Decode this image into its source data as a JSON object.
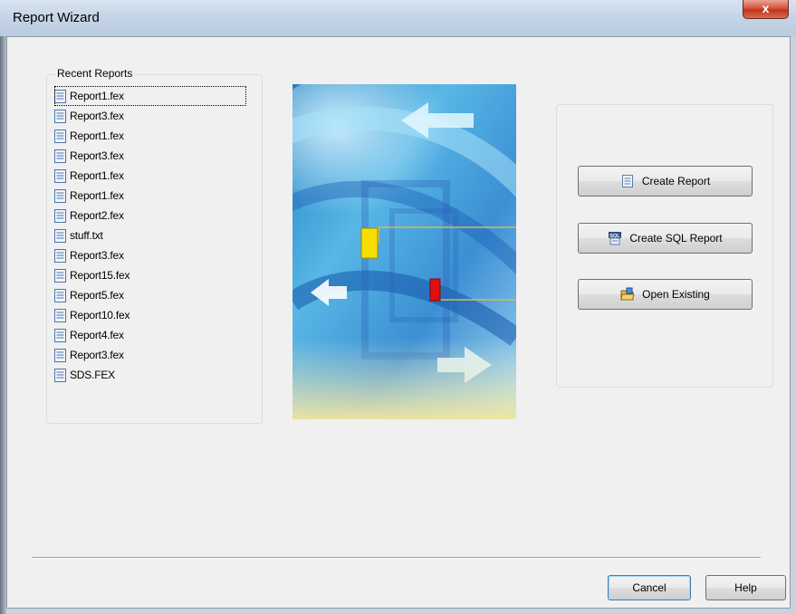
{
  "window": {
    "title": "Report Wizard",
    "close_glyph": "x"
  },
  "recent": {
    "legend": "Recent Reports",
    "items": [
      "Report1.fex",
      "Report3.fex",
      "Report1.fex",
      "Report3.fex",
      "Report1.fex",
      "Report1.fex",
      "Report2.fex",
      "stuff.txt",
      "Report3.fex",
      "Report15.fex",
      "Report5.fex",
      "Report10.fex",
      "Report4.fex",
      "Report3.fex",
      "SDS.FEX"
    ]
  },
  "actions": {
    "create_report": "Create Report",
    "create_sql_report": "Create SQL Report",
    "open_existing": "Open Existing"
  },
  "footer": {
    "cancel": "Cancel",
    "help": "Help"
  },
  "colors": {
    "titlebar": "#c6d5e7",
    "dialog_bg": "#f0f0f0",
    "accent_yellow": "#f5dd00",
    "accent_red": "#e01010"
  },
  "icons": {
    "file": "document-icon",
    "sql": "sql-icon",
    "folder": "open-folder-icon"
  }
}
